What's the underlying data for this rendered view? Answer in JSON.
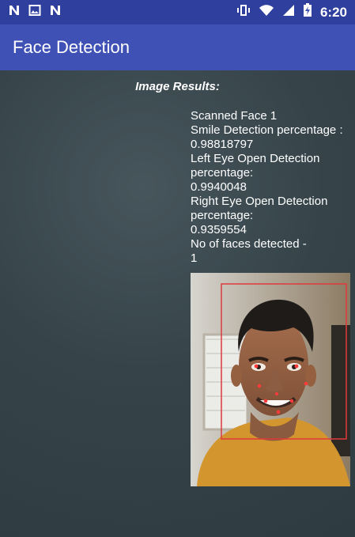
{
  "status_bar": {
    "time": "6:20"
  },
  "app_bar": {
    "title": "Face Detection"
  },
  "results": {
    "heading": "Image Results:",
    "lines": [
      "Scanned Face 1",
      "Smile Detection percentage :",
      "0.98818797",
      "Left Eye Open Detection",
      "percentage:",
      "0.9940048",
      "Right Eye Open Detection",
      "percentage:",
      "0.9359554",
      "No of faces detected -",
      "1"
    ]
  },
  "colors": {
    "status_bar": "#2f3f9e",
    "app_bar": "#3f51b5",
    "content_bg": "#36444a",
    "face_box": "#e0393c",
    "landmark": "#ff3b3b"
  },
  "icons": {
    "status_left": [
      "n-icon",
      "image-icon",
      "n-icon"
    ],
    "status_right": [
      "vibrate-icon",
      "wifi-icon",
      "signal-icon",
      "battery-charging-icon"
    ]
  }
}
